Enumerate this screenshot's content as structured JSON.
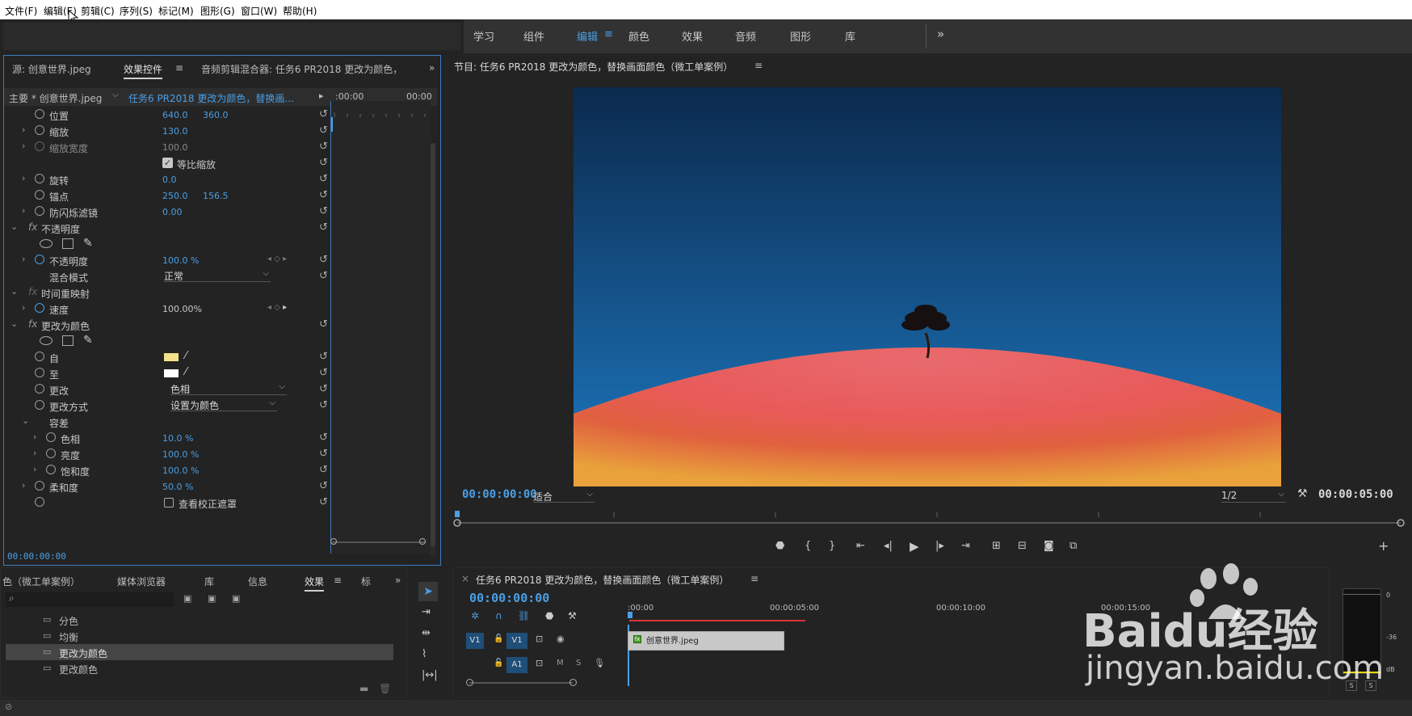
{
  "menu": {
    "items": [
      "文件(F)",
      "编辑(E)",
      "剪辑(C)",
      "序列(S)",
      "标记(M)",
      "图形(G)",
      "窗口(W)",
      "帮助(H)"
    ]
  },
  "workspaces": {
    "tabs": [
      "学习",
      "组件",
      "编辑",
      "颜色",
      "效果",
      "音频",
      "图形",
      "库"
    ],
    "more": "»"
  },
  "effect_controls": {
    "tabs": {
      "source": "源: 创意世界.jpeg",
      "effect_controls": "效果控件",
      "audio_mixer": "音频剪辑混合器: 任务6 PR2018 更改为颜色，"
    },
    "clip_selector": {
      "master": "主要 * 创意世界.jpeg",
      "sequence": "任务6 PR2018 更改为颜色，替换画..."
    },
    "ruler": {
      "start": ":00:00",
      "end": "00:00"
    },
    "rows": {
      "position": {
        "label": "位置",
        "x": "640.0",
        "y": "360.0"
      },
      "scale": {
        "label": "缩放",
        "value": "130.0"
      },
      "scale_width": {
        "label": "缩放宽度",
        "value": "100.0"
      },
      "uniform_scale": {
        "label": "等比缩放"
      },
      "rotation": {
        "label": "旋转",
        "value": "0.0"
      },
      "anchor": {
        "label": "锚点",
        "x": "250.0",
        "y": "156.5"
      },
      "flicker": {
        "label": "防闪烁滤镜",
        "value": "0.00"
      },
      "opacity_group": {
        "label": "不透明度"
      },
      "opacity": {
        "label": "不透明度",
        "value": "100.0 %"
      },
      "blend": {
        "label": "混合模式",
        "value": "正常"
      },
      "time_remap": {
        "label": "时间重映射"
      },
      "speed": {
        "label": "速度",
        "value": "100.00%"
      },
      "change_to_color": {
        "label": "更改为颜色"
      },
      "from": {
        "label": "自",
        "color": "#f4e28a"
      },
      "to": {
        "label": "至",
        "color": "#ffffff"
      },
      "change": {
        "label": "更改",
        "value": "色相"
      },
      "change_by": {
        "label": "更改方式",
        "value": "设置为颜色"
      },
      "tolerance": {
        "label": "容差"
      },
      "hue": {
        "label": "色相",
        "value": "10.0 %"
      },
      "lightness": {
        "label": "亮度",
        "value": "100.0 %"
      },
      "saturation": {
        "label": "饱和度",
        "value": "100.0 %"
      },
      "softness": {
        "label": "柔和度",
        "value": "50.0 %"
      },
      "view_mask": {
        "label": "查看校正遮罩"
      }
    },
    "timecode": "00:00:00:00"
  },
  "program": {
    "title": "节目: 任务6 PR2018 更改为颜色，替换画面颜色（微工单案例）",
    "timecode": "00:00:00:00",
    "fit": "适合",
    "resolution": "1/2",
    "duration": "00:00:05:00"
  },
  "project": {
    "tabs": [
      "色（微工单案例）",
      "媒体浏览器",
      "库",
      "信息",
      "效果",
      "标"
    ],
    "items": [
      "分色",
      "均衡",
      "更改为颜色",
      "更改颜色"
    ]
  },
  "timeline": {
    "title": "任务6 PR2018 更改为颜色，替换画面颜色（微工单案例）",
    "timecode": "00:00:00:00",
    "ruler": [
      ":00:00",
      "00:00:05:00",
      "00:00:10:00",
      "00:00:15:00"
    ],
    "tracks": {
      "v1": "V1",
      "a1": "A1",
      "m": "M",
      "s": "S"
    },
    "clip": "创意世界.jpeg"
  },
  "meter": {
    "labels": [
      "0",
      "-36",
      "dB"
    ],
    "solo": [
      "S",
      "S"
    ]
  },
  "watermark": {
    "brand": "Baidu经验",
    "url": "jingyan.baidu.com"
  },
  "colors": {
    "accent": "#4a9fe6",
    "panel": "#232323",
    "sky_top": "#0b2a4d",
    "sky_bottom": "#1d78c0",
    "planet": "#e85a5a",
    "planet_rim": "#e9a23b"
  }
}
